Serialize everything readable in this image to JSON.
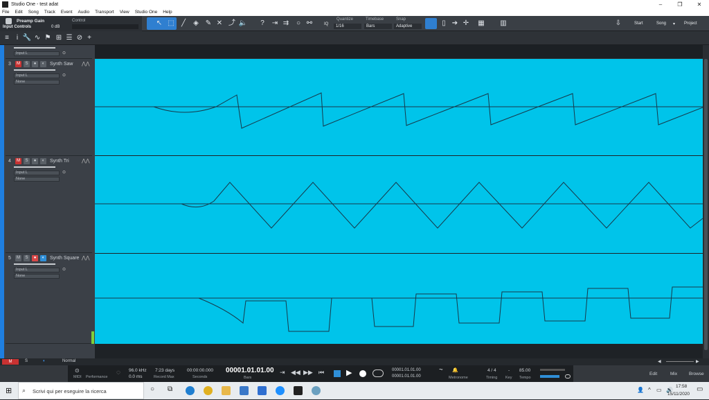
{
  "window": {
    "title": "Studio One - test adat",
    "controls": [
      "–",
      "❐",
      "✕"
    ]
  },
  "menu": [
    "File",
    "Edit",
    "Song",
    "Track",
    "Event",
    "Audio",
    "Transport",
    "View",
    "Studio One",
    "Help"
  ],
  "toolbar": {
    "preamp_label": "Preamp Gain",
    "input_controls": "Input Controls",
    "preamp_value": "0 dB",
    "control_label": "Control",
    "iq_label": "IQ",
    "quantize_label": "Quantize",
    "quantize_value": "1/16",
    "timebase_label": "Timebase",
    "timebase_value": "Bars",
    "snap_label": "Snap",
    "snap_value": "Adaptive",
    "start": "Start",
    "song": "Song",
    "project": "Project"
  },
  "tracks": [
    {
      "num": "3",
      "name": "Synth Saw",
      "input": "Input L",
      "output": "None",
      "mute_on": true,
      "record_on": false
    },
    {
      "num": "4",
      "name": "Synth Tri",
      "input": "Input L",
      "output": "None",
      "mute_on": true,
      "record_on": false
    },
    {
      "num": "5",
      "name": "Synth Square",
      "input": "Input L",
      "output": "None",
      "mute_on": false,
      "record_on": true
    }
  ],
  "track_prev_input": "Input L",
  "status": {
    "m": "M",
    "s": "S",
    "mode": "Normal"
  },
  "transport": {
    "midi": "MIDI",
    "performance": "Performance",
    "sample_rate": "96.0 kHz",
    "latency": "0.0 ms",
    "record_time": "7:23 days",
    "record_max": "Record Max",
    "seconds_value": "00:00:00.000",
    "seconds_label": "Seconds",
    "position": "00001.01.01.00",
    "bars_label": "Bars",
    "loop_l": "00001.01.01.00",
    "loop_r": "00001.01.01.00",
    "metronome": "Metronome",
    "timing_value": "4 / 4",
    "timing_label": "Timing",
    "key_value": "-",
    "key_label": "Key",
    "tempo_value": "85.00",
    "tempo_label": "Tempo",
    "edit": "Edit",
    "mix": "Mix",
    "browse": "Browse"
  },
  "taskbar": {
    "search_placeholder": "Scrivi qui per eseguire la ricerca",
    "time": "17:58",
    "date": "15/11/2020"
  }
}
